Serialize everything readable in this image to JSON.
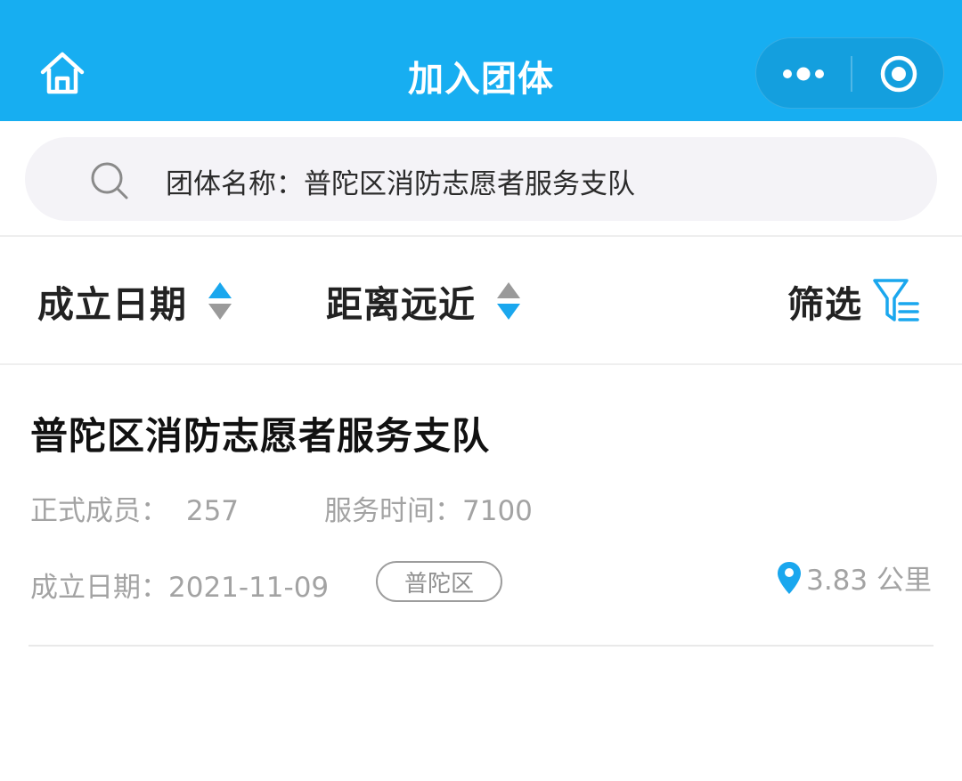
{
  "navbar": {
    "title": "加入团体",
    "background": "#17aef1",
    "home_icon": "home-icon",
    "more_icon": "more-dots-icon",
    "close_icon": "target-circle-icon"
  },
  "search": {
    "label": "团体名称：",
    "value": "普陀区消防志愿者服务支队",
    "icon": "search-icon"
  },
  "sort_bar": {
    "items": [
      {
        "label": "成立日期",
        "icon": "sort-up-active-icon"
      },
      {
        "label": "距离远近",
        "icon": "sort-down-active-icon"
      }
    ],
    "filter_label": "筛选",
    "filter_icon": "filter-icon",
    "accent": "#1aa7ee"
  },
  "results": [
    {
      "name": "普陀区消防志愿者服务支队",
      "members_label": "正式成员：",
      "members_value": "257",
      "service_label": "服务时间：",
      "service_value": "7100",
      "founded_label": "成立日期：",
      "founded_value": "2021-11-09",
      "district_tag": "普陀区",
      "distance": "3.83 公里",
      "distance_icon": "location-pin-icon"
    }
  ]
}
